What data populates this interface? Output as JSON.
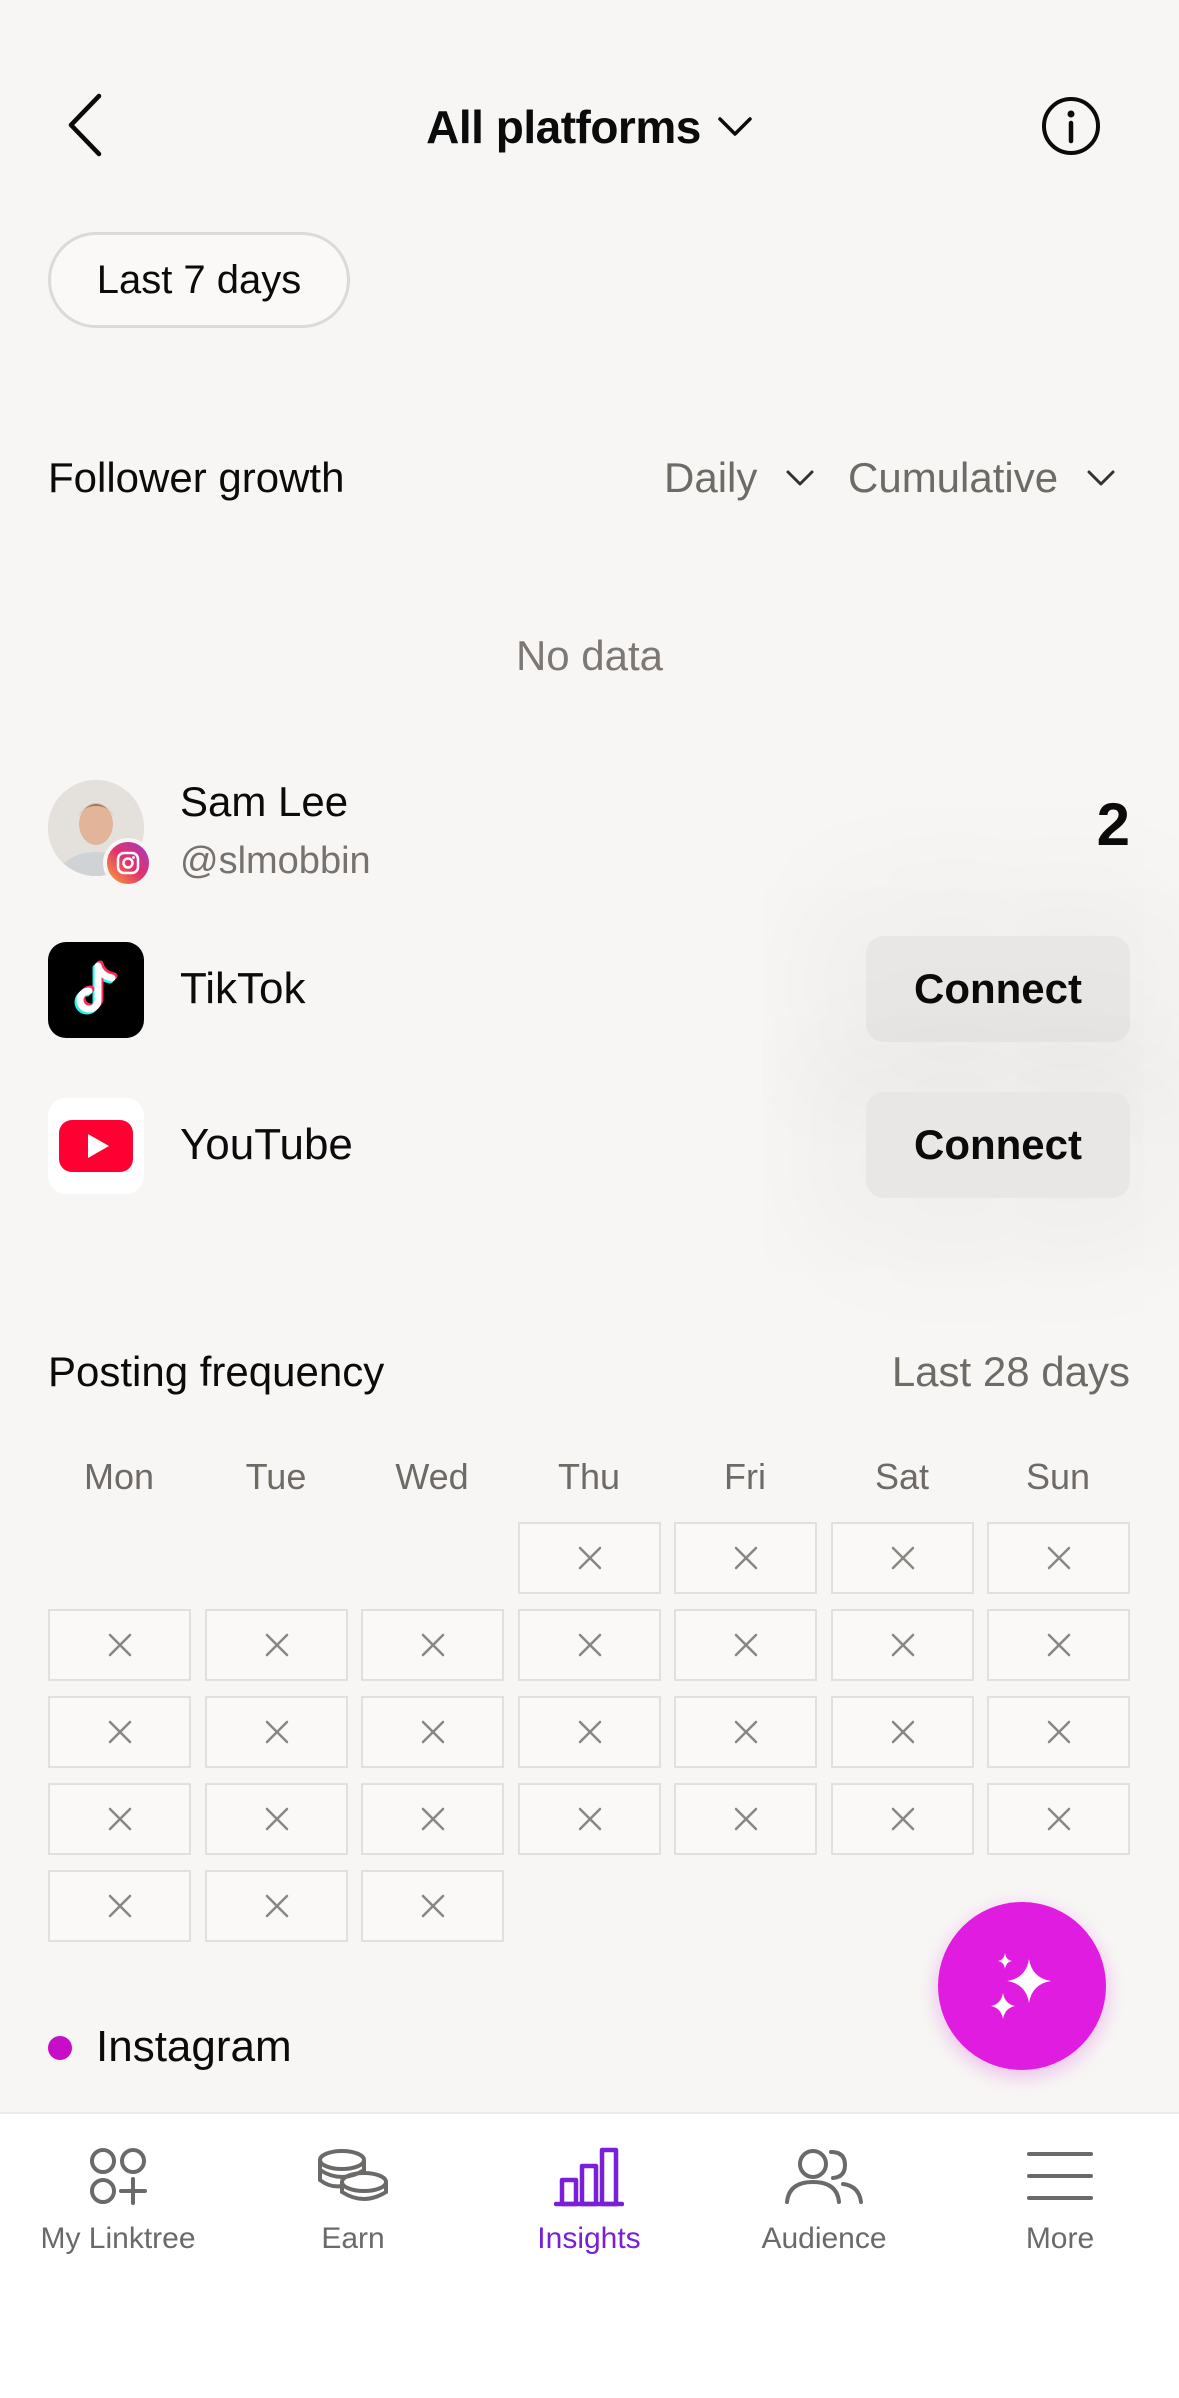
{
  "header": {
    "title": "All platforms"
  },
  "date_range": {
    "label": "Last 7 days"
  },
  "follower_growth": {
    "title": "Follower growth",
    "interval": "Daily",
    "mode": "Cumulative",
    "empty_text": "No data"
  },
  "accounts": [
    {
      "name": "Sam Lee",
      "handle": "@slmobbin",
      "count": "2",
      "platform_icon": "instagram-icon"
    }
  ],
  "platforms": [
    {
      "label": "TikTok",
      "action": "Connect",
      "icon": "tiktok-icon"
    },
    {
      "label": "YouTube",
      "action": "Connect",
      "icon": "youtube-icon"
    }
  ],
  "posting_frequency": {
    "title": "Posting frequency",
    "range": "Last 28 days",
    "days": [
      "Mon",
      "Tue",
      "Wed",
      "Thu",
      "Fri",
      "Sat",
      "Sun"
    ],
    "weeks": [
      [
        null,
        null,
        null,
        "x",
        "x",
        "x",
        "x"
      ],
      [
        "x",
        "x",
        "x",
        "x",
        "x",
        "x",
        "x"
      ],
      [
        "x",
        "x",
        "x",
        "x",
        "x",
        "x",
        "x"
      ],
      [
        "x",
        "x",
        "x",
        "x",
        "x",
        "x",
        "x"
      ],
      [
        "x",
        "x",
        "x",
        null,
        null,
        null,
        null
      ]
    ],
    "legend": [
      {
        "label": "Instagram",
        "color": "#c80dc8"
      }
    ]
  },
  "nav": {
    "items": [
      {
        "label": "My Linktree",
        "icon": "linktree-icon"
      },
      {
        "label": "Earn",
        "icon": "coins-icon"
      },
      {
        "label": "Insights",
        "icon": "bar-chart-icon",
        "active": true
      },
      {
        "label": "Audience",
        "icon": "people-icon"
      },
      {
        "label": "More",
        "icon": "menu-icon"
      }
    ]
  },
  "colors": {
    "accent": "#7a1fd8",
    "fab": "#e01ce0",
    "instagram": "#c80dc8"
  }
}
